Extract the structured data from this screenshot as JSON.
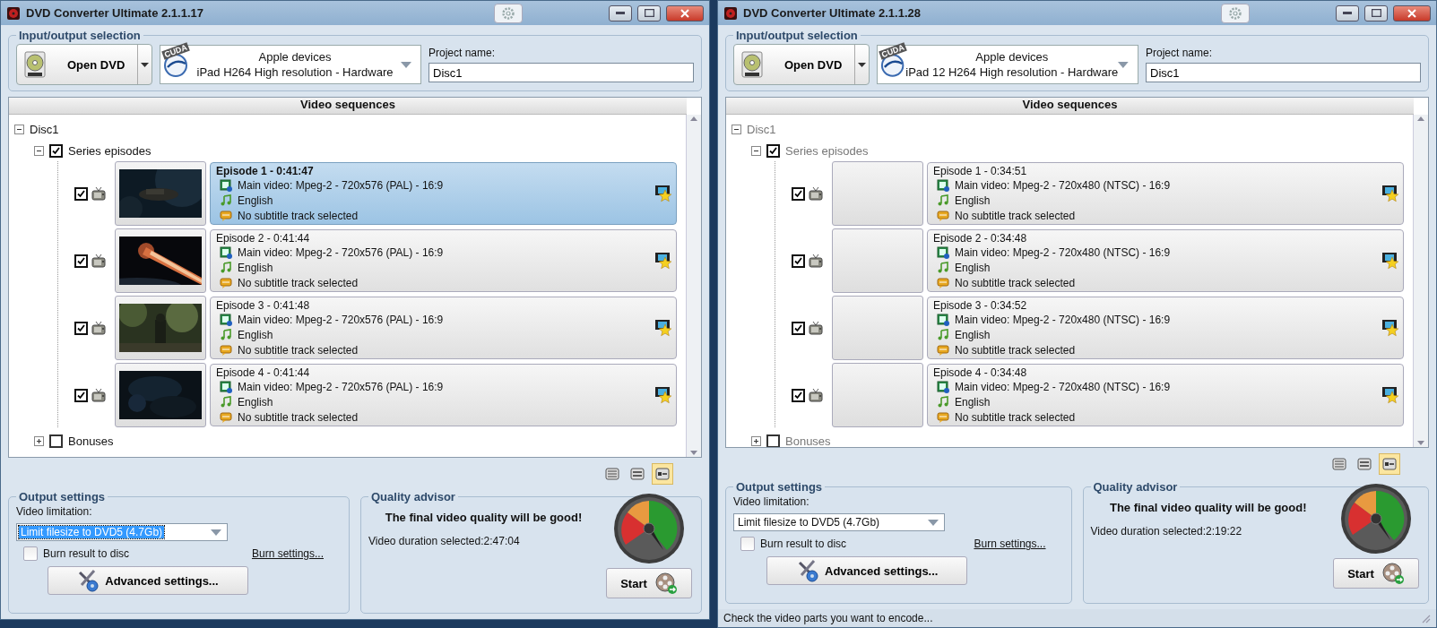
{
  "windows": [
    {
      "title": "DVD Converter Ultimate 2.1.1.17",
      "io": {
        "label": "Input/output selection",
        "open_button": "Open DVD",
        "profile": {
          "badge": "CUDA",
          "line1": "Apple devices",
          "line2": "iPad H264 High resolution - Hardware"
        },
        "project_label": "Project name:",
        "project_value": "Disc1"
      },
      "sequences": {
        "header": "Video sequences",
        "disabled": false,
        "tree": [
          {
            "label": "Disc1",
            "expanded": true,
            "children": [
              {
                "label": "Series episodes",
                "checked": true,
                "expanded": true,
                "children": [
                  {
                    "title": "Episode 1 - 0:41:47",
                    "selected": true,
                    "checked": true,
                    "thumbnail": true,
                    "video": "Main video: Mpeg-2 - 720x576 (PAL) - 16:9",
                    "audio": "English",
                    "subtitle": "No subtitle track selected"
                  },
                  {
                    "title": "Episode 2 - 0:41:44",
                    "selected": false,
                    "checked": true,
                    "thumbnail": true,
                    "video": "Main video: Mpeg-2 - 720x576 (PAL) - 16:9",
                    "audio": "English",
                    "subtitle": "No subtitle track selected"
                  },
                  {
                    "title": "Episode 3 - 0:41:48",
                    "selected": false,
                    "checked": true,
                    "thumbnail": true,
                    "video": "Main video: Mpeg-2 - 720x576 (PAL) - 16:9",
                    "audio": "English",
                    "subtitle": "No subtitle track selected"
                  },
                  {
                    "title": "Episode 4 - 0:41:44",
                    "selected": false,
                    "checked": true,
                    "thumbnail": true,
                    "video": "Main video: Mpeg-2 - 720x576 (PAL) - 16:9",
                    "audio": "English",
                    "subtitle": "No subtitle track selected"
                  }
                ]
              },
              {
                "label": "Bonuses",
                "checked": false,
                "expanded": false
              }
            ]
          }
        ]
      },
      "view_modes": [
        {
          "kind": "details",
          "selected": false
        },
        {
          "kind": "list",
          "selected": false
        },
        {
          "kind": "thumbnails",
          "selected": true
        }
      ],
      "output": {
        "label": "Output settings",
        "limit_label": "Video limitation:",
        "limit_value": "Limit filesize to DVD5 (4.7Gb)",
        "limit_focused": true,
        "burn_label": "Burn result to disc",
        "burn_checked": false,
        "burn_link": "Burn settings...",
        "advanced": "Advanced settings..."
      },
      "quality": {
        "label": "Quality advisor",
        "message": "The final video quality will be good!",
        "duration": "Video duration selected:2:47:04",
        "start": "Start"
      }
    },
    {
      "title": "DVD Converter Ultimate 2.1.1.28",
      "io": {
        "label": "Input/output selection",
        "open_button": "Open DVD",
        "profile": {
          "badge": "CUDA",
          "line1": "Apple devices",
          "line2": "iPad 12 H264 High resolution - Hardware"
        },
        "project_label": "Project name:",
        "project_value": "Disc1"
      },
      "sequences": {
        "header": "Video sequences",
        "disabled": true,
        "tree": [
          {
            "label": "Disc1",
            "expanded": true,
            "children": [
              {
                "label": "Series episodes",
                "checked": true,
                "expanded": true,
                "children": [
                  {
                    "title": "Episode 1 - 0:34:51",
                    "selected": false,
                    "checked": true,
                    "thumbnail": false,
                    "video": "Main video: Mpeg-2 - 720x480 (NTSC) - 16:9",
                    "audio": "English",
                    "subtitle": "No subtitle track selected"
                  },
                  {
                    "title": "Episode 2 - 0:34:48",
                    "selected": false,
                    "checked": true,
                    "thumbnail": false,
                    "video": "Main video: Mpeg-2 - 720x480 (NTSC) - 16:9",
                    "audio": "English",
                    "subtitle": "No subtitle track selected"
                  },
                  {
                    "title": "Episode 3 - 0:34:52",
                    "selected": false,
                    "checked": true,
                    "thumbnail": false,
                    "video": "Main video: Mpeg-2 - 720x480 (NTSC) - 16:9",
                    "audio": "English",
                    "subtitle": "No subtitle track selected"
                  },
                  {
                    "title": "Episode 4 - 0:34:48",
                    "selected": false,
                    "checked": true,
                    "thumbnail": false,
                    "video": "Main video: Mpeg-2 - 720x480 (NTSC) - 16:9",
                    "audio": "English",
                    "subtitle": "No subtitle track selected"
                  }
                ]
              },
              {
                "label": "Bonuses",
                "checked": false,
                "expanded": false
              }
            ]
          }
        ]
      },
      "view_modes": [
        {
          "kind": "details",
          "selected": false
        },
        {
          "kind": "list",
          "selected": false
        },
        {
          "kind": "thumbnails",
          "selected": true
        }
      ],
      "output": {
        "label": "Output settings",
        "limit_label": "Video limitation:",
        "limit_value": "Limit filesize to DVD5 (4.7Gb)",
        "limit_focused": false,
        "burn_label": "Burn result to disc",
        "burn_checked": false,
        "burn_link": "Burn settings...",
        "advanced": "Advanced settings..."
      },
      "quality": {
        "label": "Quality advisor",
        "message": "The final video quality will be good!",
        "duration": "Video duration selected:2:19:22",
        "start": "Start"
      },
      "status_bar": "Check the video parts you want to encode..."
    }
  ]
}
